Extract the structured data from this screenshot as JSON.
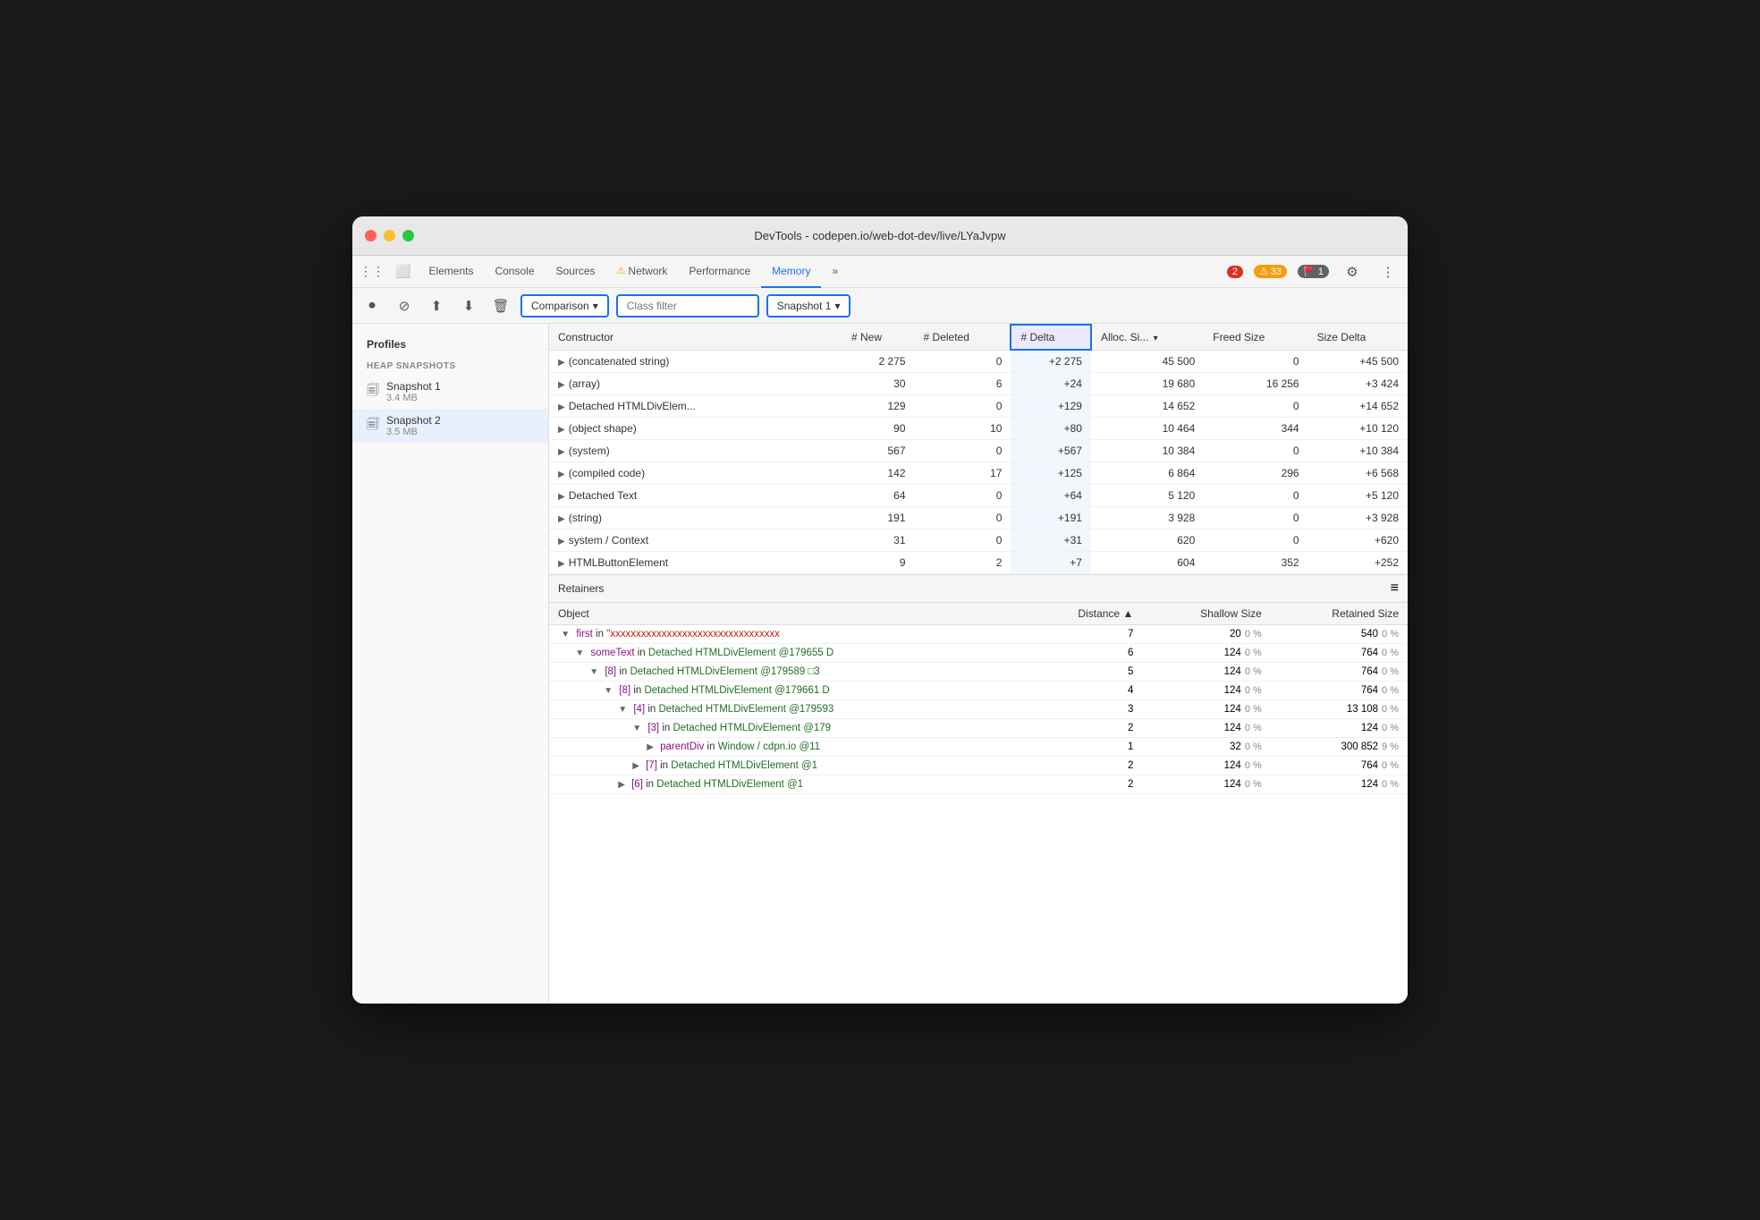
{
  "window": {
    "title": "DevTools - codepen.io/web-dot-dev/live/LYaJvpw"
  },
  "tabs": {
    "items": [
      {
        "label": "Elements",
        "active": false
      },
      {
        "label": "Console",
        "active": false
      },
      {
        "label": "Sources",
        "active": false
      },
      {
        "label": "Network",
        "active": false,
        "warning": true
      },
      {
        "label": "Performance",
        "active": false
      },
      {
        "label": "Memory",
        "active": true
      },
      {
        "label": "»",
        "active": false
      }
    ],
    "badges": {
      "error": "2",
      "warn": "33",
      "flag": "1"
    }
  },
  "toolbar": {
    "comparison_label": "Comparison",
    "class_filter_placeholder": "Class filter",
    "snapshot_label": "Snapshot 1"
  },
  "columns": {
    "constructor": "Constructor",
    "new": "# New",
    "deleted": "# Deleted",
    "delta": "# Delta",
    "alloc_size": "Alloc. Si...",
    "freed_size": "Freed Size",
    "size_delta": "Size Delta"
  },
  "table_rows": [
    {
      "constructor": "(concatenated string)",
      "new": "2 275",
      "deleted": "0",
      "delta": "+2 275",
      "alloc_size": "45 500",
      "freed_size": "0",
      "size_delta": "+45 500"
    },
    {
      "constructor": "(array)",
      "new": "30",
      "deleted": "6",
      "delta": "+24",
      "alloc_size": "19 680",
      "freed_size": "16 256",
      "size_delta": "+3 424"
    },
    {
      "constructor": "Detached HTMLDivElem...",
      "new": "129",
      "deleted": "0",
      "delta": "+129",
      "alloc_size": "14 652",
      "freed_size": "0",
      "size_delta": "+14 652"
    },
    {
      "constructor": "(object shape)",
      "new": "90",
      "deleted": "10",
      "delta": "+80",
      "alloc_size": "10 464",
      "freed_size": "344",
      "size_delta": "+10 120"
    },
    {
      "constructor": "(system)",
      "new": "567",
      "deleted": "0",
      "delta": "+567",
      "alloc_size": "10 384",
      "freed_size": "0",
      "size_delta": "+10 384"
    },
    {
      "constructor": "(compiled code)",
      "new": "142",
      "deleted": "17",
      "delta": "+125",
      "alloc_size": "6 864",
      "freed_size": "296",
      "size_delta": "+6 568"
    },
    {
      "constructor": "Detached Text",
      "new": "64",
      "deleted": "0",
      "delta": "+64",
      "alloc_size": "5 120",
      "freed_size": "0",
      "size_delta": "+5 120"
    },
    {
      "constructor": "(string)",
      "new": "191",
      "deleted": "0",
      "delta": "+191",
      "alloc_size": "3 928",
      "freed_size": "0",
      "size_delta": "+3 928"
    },
    {
      "constructor": "system / Context",
      "new": "31",
      "deleted": "0",
      "delta": "+31",
      "alloc_size": "620",
      "freed_size": "0",
      "size_delta": "+620"
    },
    {
      "constructor": "HTMLButtonElement",
      "new": "9",
      "deleted": "2",
      "delta": "+7",
      "alloc_size": "604",
      "freed_size": "352",
      "size_delta": "+252"
    }
  ],
  "retainers": {
    "title": "Retainers",
    "columns": {
      "object": "Object",
      "distance": "Distance",
      "shallow_size": "Shallow Size",
      "retained_size": "Retained Size"
    },
    "rows": [
      {
        "indent": 0,
        "expand": "▼",
        "prefix": "first",
        "prefix_class": "object-key",
        "middle": " in ",
        "suffix": "\"xxxxxxxxxxxxxxxxxxxxxxxxxxxxxxxxx",
        "suffix_class": "object-string",
        "distance": "7",
        "shallow_size": "20",
        "shallow_pct": "0 %",
        "retained_size": "540",
        "retained_pct": "0 %"
      },
      {
        "indent": 1,
        "expand": "▼",
        "prefix": "someText",
        "prefix_class": "object-key",
        "middle": " in ",
        "suffix": "Detached HTMLDivElement @179655 D",
        "suffix_class": "object-ref",
        "distance": "6",
        "shallow_size": "124",
        "shallow_pct": "0 %",
        "retained_size": "764",
        "retained_pct": "0 %"
      },
      {
        "indent": 2,
        "expand": "▼",
        "prefix": "[8]",
        "prefix_class": "object-key",
        "middle": " in ",
        "suffix": "Detached HTMLDivElement @179589 □3",
        "suffix_class": "object-ref",
        "distance": "5",
        "shallow_size": "124",
        "shallow_pct": "0 %",
        "retained_size": "764",
        "retained_pct": "0 %"
      },
      {
        "indent": 3,
        "expand": "▼",
        "prefix": "[8]",
        "prefix_class": "object-key",
        "middle": " in ",
        "suffix": "Detached HTMLDivElement @179661 D",
        "suffix_class": "object-ref",
        "distance": "4",
        "shallow_size": "124",
        "shallow_pct": "0 %",
        "retained_size": "764",
        "retained_pct": "0 %"
      },
      {
        "indent": 4,
        "expand": "▼",
        "prefix": "[4]",
        "prefix_class": "object-key",
        "middle": " in ",
        "suffix": "Detached HTMLDivElement @179593",
        "suffix_class": "object-ref",
        "distance": "3",
        "shallow_size": "124",
        "shallow_pct": "0 %",
        "retained_size": "13 108",
        "retained_pct": "0 %"
      },
      {
        "indent": 5,
        "expand": "▼",
        "prefix": "[3]",
        "prefix_class": "object-key",
        "middle": " in ",
        "suffix": "Detached HTMLDivElement @179",
        "suffix_class": "object-ref",
        "distance": "2",
        "shallow_size": "124",
        "shallow_pct": "0 %",
        "retained_size": "124",
        "retained_pct": "0 %"
      },
      {
        "indent": 6,
        "expand": "▶",
        "prefix": "parentDiv",
        "prefix_class": "object-key",
        "middle": " in ",
        "suffix": "Window / cdpn.io @11",
        "suffix_class": "object-ref",
        "distance": "1",
        "shallow_size": "32",
        "shallow_pct": "0 %",
        "retained_size": "300 852",
        "retained_pct": "9 %"
      },
      {
        "indent": 5,
        "expand": "▶",
        "prefix": "[7]",
        "prefix_class": "object-key",
        "middle": " in ",
        "suffix": "Detached HTMLDivElement @1",
        "suffix_class": "object-ref",
        "distance": "2",
        "shallow_size": "124",
        "shallow_pct": "0 %",
        "retained_size": "764",
        "retained_pct": "0 %"
      },
      {
        "indent": 4,
        "expand": "▶",
        "prefix": "[6]",
        "prefix_class": "object-key",
        "middle": " in ",
        "suffix": "Detached HTMLDivElement @1",
        "suffix_class": "object-ref",
        "distance": "2",
        "shallow_size": "124",
        "shallow_pct": "0 %",
        "retained_size": "124",
        "retained_pct": "0 %"
      }
    ]
  },
  "sidebar": {
    "profiles_title": "Profiles",
    "heap_snapshots_title": "HEAP SNAPSHOTS",
    "items": [
      {
        "name": "Snapshot 1",
        "size": "3.4 MB",
        "active": false
      },
      {
        "name": "Snapshot 2",
        "size": "3.5 MB",
        "active": true
      }
    ]
  }
}
